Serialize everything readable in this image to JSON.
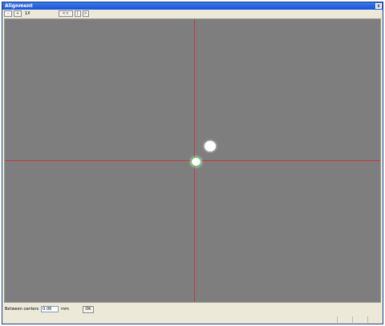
{
  "window": {
    "title": "Alignment",
    "close_label": "x"
  },
  "toolbar": {
    "zoom_out_label": "-",
    "zoom_in_label": "+",
    "zoom_level": "1X",
    "nav_buttons": [
      "<<",
      "|",
      ">"
    ]
  },
  "viewport": {
    "crosshair_color": "#c83838",
    "target_outline_color": "#3fcf3f"
  },
  "status": {
    "label": "Between centers",
    "value": "0.06",
    "unit": "mm",
    "ok_label": "OK"
  }
}
